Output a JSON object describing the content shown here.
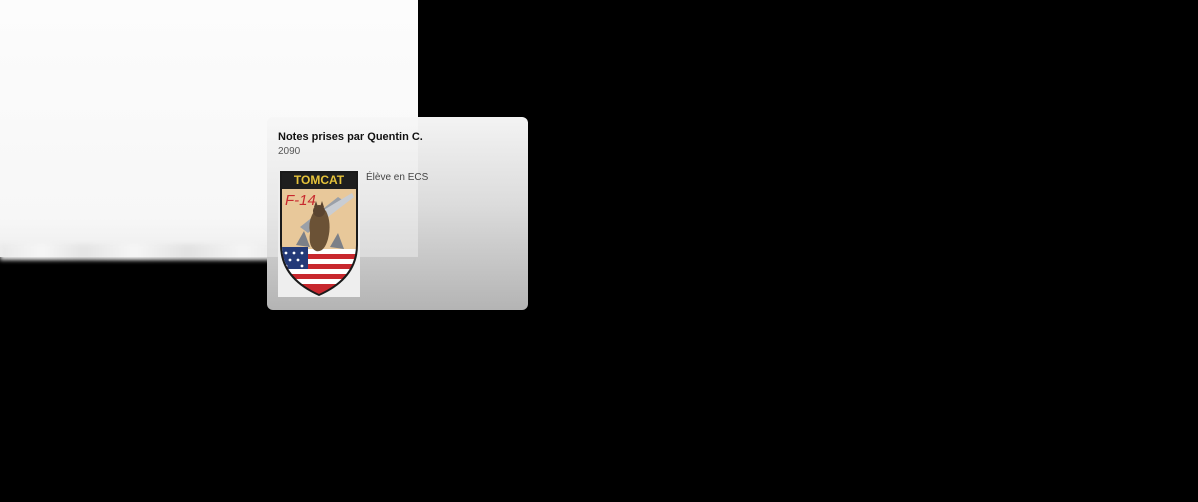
{
  "card": {
    "title": "Notes prises par Quentin C.",
    "subtitle": "2090",
    "description": "Élève en ECS"
  },
  "patch": {
    "top_text": "TOMCAT",
    "side_text": "F-14",
    "colors": {
      "border": "#1a1a1a",
      "top_band": "#1e1e1e",
      "gold": "#d8b85a",
      "text_gold": "#e6c33a",
      "red": "#c8282e",
      "navy": "#243a78",
      "tan": "#e8c89a"
    }
  }
}
